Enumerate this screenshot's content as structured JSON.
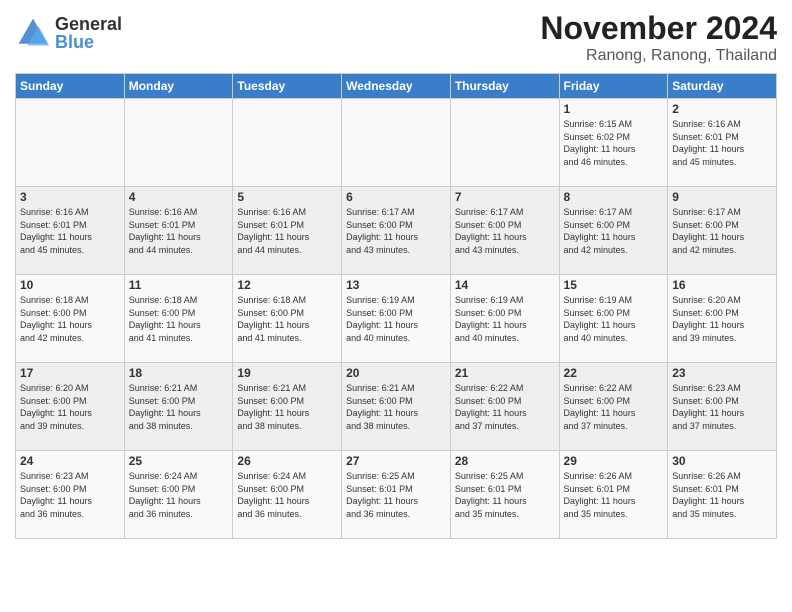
{
  "logo": {
    "general": "General",
    "blue": "Blue"
  },
  "title": "November 2024",
  "location": "Ranong, Ranong, Thailand",
  "weekdays": [
    "Sunday",
    "Monday",
    "Tuesday",
    "Wednesday",
    "Thursday",
    "Friday",
    "Saturday"
  ],
  "weeks": [
    [
      {
        "day": "",
        "info": ""
      },
      {
        "day": "",
        "info": ""
      },
      {
        "day": "",
        "info": ""
      },
      {
        "day": "",
        "info": ""
      },
      {
        "day": "",
        "info": ""
      },
      {
        "day": "1",
        "info": "Sunrise: 6:15 AM\nSunset: 6:02 PM\nDaylight: 11 hours\nand 46 minutes."
      },
      {
        "day": "2",
        "info": "Sunrise: 6:16 AM\nSunset: 6:01 PM\nDaylight: 11 hours\nand 45 minutes."
      }
    ],
    [
      {
        "day": "3",
        "info": "Sunrise: 6:16 AM\nSunset: 6:01 PM\nDaylight: 11 hours\nand 45 minutes."
      },
      {
        "day": "4",
        "info": "Sunrise: 6:16 AM\nSunset: 6:01 PM\nDaylight: 11 hours\nand 44 minutes."
      },
      {
        "day": "5",
        "info": "Sunrise: 6:16 AM\nSunset: 6:01 PM\nDaylight: 11 hours\nand 44 minutes."
      },
      {
        "day": "6",
        "info": "Sunrise: 6:17 AM\nSunset: 6:00 PM\nDaylight: 11 hours\nand 43 minutes."
      },
      {
        "day": "7",
        "info": "Sunrise: 6:17 AM\nSunset: 6:00 PM\nDaylight: 11 hours\nand 43 minutes."
      },
      {
        "day": "8",
        "info": "Sunrise: 6:17 AM\nSunset: 6:00 PM\nDaylight: 11 hours\nand 42 minutes."
      },
      {
        "day": "9",
        "info": "Sunrise: 6:17 AM\nSunset: 6:00 PM\nDaylight: 11 hours\nand 42 minutes."
      }
    ],
    [
      {
        "day": "10",
        "info": "Sunrise: 6:18 AM\nSunset: 6:00 PM\nDaylight: 11 hours\nand 42 minutes."
      },
      {
        "day": "11",
        "info": "Sunrise: 6:18 AM\nSunset: 6:00 PM\nDaylight: 11 hours\nand 41 minutes."
      },
      {
        "day": "12",
        "info": "Sunrise: 6:18 AM\nSunset: 6:00 PM\nDaylight: 11 hours\nand 41 minutes."
      },
      {
        "day": "13",
        "info": "Sunrise: 6:19 AM\nSunset: 6:00 PM\nDaylight: 11 hours\nand 40 minutes."
      },
      {
        "day": "14",
        "info": "Sunrise: 6:19 AM\nSunset: 6:00 PM\nDaylight: 11 hours\nand 40 minutes."
      },
      {
        "day": "15",
        "info": "Sunrise: 6:19 AM\nSunset: 6:00 PM\nDaylight: 11 hours\nand 40 minutes."
      },
      {
        "day": "16",
        "info": "Sunrise: 6:20 AM\nSunset: 6:00 PM\nDaylight: 11 hours\nand 39 minutes."
      }
    ],
    [
      {
        "day": "17",
        "info": "Sunrise: 6:20 AM\nSunset: 6:00 PM\nDaylight: 11 hours\nand 39 minutes."
      },
      {
        "day": "18",
        "info": "Sunrise: 6:21 AM\nSunset: 6:00 PM\nDaylight: 11 hours\nand 38 minutes."
      },
      {
        "day": "19",
        "info": "Sunrise: 6:21 AM\nSunset: 6:00 PM\nDaylight: 11 hours\nand 38 minutes."
      },
      {
        "day": "20",
        "info": "Sunrise: 6:21 AM\nSunset: 6:00 PM\nDaylight: 11 hours\nand 38 minutes."
      },
      {
        "day": "21",
        "info": "Sunrise: 6:22 AM\nSunset: 6:00 PM\nDaylight: 11 hours\nand 37 minutes."
      },
      {
        "day": "22",
        "info": "Sunrise: 6:22 AM\nSunset: 6:00 PM\nDaylight: 11 hours\nand 37 minutes."
      },
      {
        "day": "23",
        "info": "Sunrise: 6:23 AM\nSunset: 6:00 PM\nDaylight: 11 hours\nand 37 minutes."
      }
    ],
    [
      {
        "day": "24",
        "info": "Sunrise: 6:23 AM\nSunset: 6:00 PM\nDaylight: 11 hours\nand 36 minutes."
      },
      {
        "day": "25",
        "info": "Sunrise: 6:24 AM\nSunset: 6:00 PM\nDaylight: 11 hours\nand 36 minutes."
      },
      {
        "day": "26",
        "info": "Sunrise: 6:24 AM\nSunset: 6:00 PM\nDaylight: 11 hours\nand 36 minutes."
      },
      {
        "day": "27",
        "info": "Sunrise: 6:25 AM\nSunset: 6:01 PM\nDaylight: 11 hours\nand 36 minutes."
      },
      {
        "day": "28",
        "info": "Sunrise: 6:25 AM\nSunset: 6:01 PM\nDaylight: 11 hours\nand 35 minutes."
      },
      {
        "day": "29",
        "info": "Sunrise: 6:26 AM\nSunset: 6:01 PM\nDaylight: 11 hours\nand 35 minutes."
      },
      {
        "day": "30",
        "info": "Sunrise: 6:26 AM\nSunset: 6:01 PM\nDaylight: 11 hours\nand 35 minutes."
      }
    ]
  ]
}
